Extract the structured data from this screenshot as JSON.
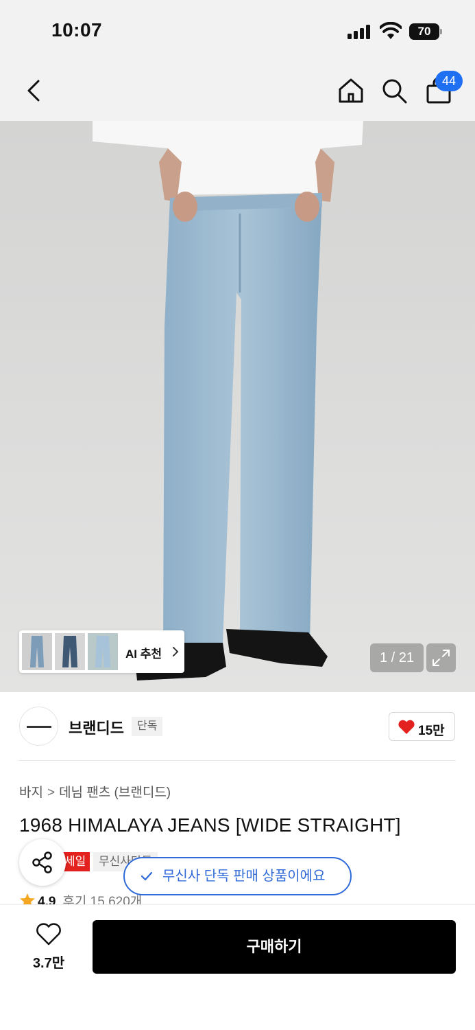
{
  "status_bar": {
    "time": "10:07",
    "battery": "70"
  },
  "nav": {
    "cart_badge": "44",
    "icons": [
      "chevron-left-icon",
      "home-icon",
      "search-icon",
      "shopping-bag-icon"
    ]
  },
  "gallery": {
    "counter": "1 / 21",
    "ai_label": "AI 추천"
  },
  "brand": {
    "name": "브랜디드",
    "tag": "단독",
    "likes": "15만"
  },
  "product": {
    "breadcrumb": [
      "바지",
      "데님 팬츠 (브랜디드)"
    ],
    "title": "1968 HIMALAYA JEANS [WIDE STRAIGHT]",
    "tag_sale_partial": "세일",
    "tag_musinsa_partial": "무신사단독",
    "rating": "4.9",
    "reviews": "후기 15,620개"
  },
  "toast": {
    "text": "무신사 단독 판매 상품이에요"
  },
  "bottom_bar": {
    "wish_count": "3.7만",
    "buy_label": "구매하기"
  },
  "colors": {
    "accent_blue": "#1f6ff2",
    "sale_red": "#e3221f",
    "heart_red": "#e3221f",
    "star_orange": "#f5a623",
    "button_black": "#000000"
  }
}
